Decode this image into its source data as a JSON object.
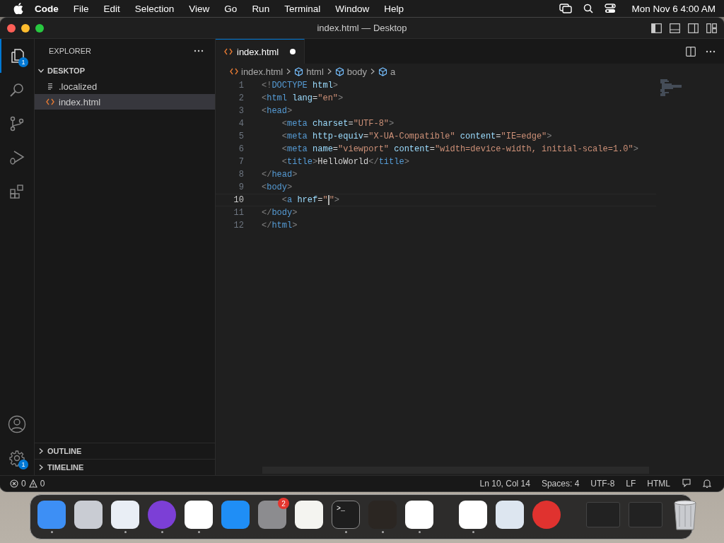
{
  "menu_bar": {
    "app_name": "Code",
    "items": [
      "File",
      "Edit",
      "Selection",
      "View",
      "Go",
      "Run",
      "Terminal",
      "Window",
      "Help"
    ],
    "clock": "Mon Nov 6  4:00 AM"
  },
  "window": {
    "title": "index.html — Desktop"
  },
  "activity_bar": {
    "items": [
      {
        "kind": "files",
        "selected": true,
        "badge": "1"
      },
      {
        "kind": "search",
        "selected": false
      },
      {
        "kind": "source-control",
        "selected": false
      },
      {
        "kind": "run-debug",
        "selected": false
      },
      {
        "kind": "extensions",
        "selected": false
      }
    ],
    "bottom_items": [
      {
        "kind": "account"
      },
      {
        "kind": "settings",
        "badge": "1"
      }
    ]
  },
  "sidebar": {
    "title": "EXPLORER",
    "folder": {
      "name": "DESKTOP",
      "expanded": true,
      "files": [
        {
          "name": ".localized",
          "kind": "plain",
          "selected": false
        },
        {
          "name": "index.html",
          "kind": "html",
          "selected": true
        }
      ]
    },
    "sections": [
      {
        "name": "OUTLINE",
        "expanded": false
      },
      {
        "name": "TIMELINE",
        "expanded": false
      }
    ]
  },
  "tabs": [
    {
      "label": "index.html",
      "selected": true,
      "modified": true
    }
  ],
  "breadcrumbs": [
    {
      "label": "index.html",
      "kind": "file"
    },
    {
      "label": "html",
      "kind": "element"
    },
    {
      "label": "body",
      "kind": "element"
    },
    {
      "label": "a",
      "kind": "element"
    }
  ],
  "code_lines": [
    {
      "number": "1",
      "current": false,
      "tokens": [
        {
          "kind": "punct",
          "text": "<!"
        },
        {
          "kind": "tag",
          "text": "DOCTYPE"
        },
        {
          "kind": "attr",
          "text": " html"
        },
        {
          "kind": "punct",
          "text": ">"
        }
      ]
    },
    {
      "number": "2",
      "current": false,
      "tokens": [
        {
          "kind": "punct",
          "text": "<"
        },
        {
          "kind": "tag",
          "text": "html"
        },
        {
          "kind": "attr",
          "text": " lang"
        },
        {
          "kind": "text",
          "text": "="
        },
        {
          "kind": "string",
          "text": "\"en\""
        },
        {
          "kind": "punct",
          "text": ">"
        }
      ]
    },
    {
      "number": "3",
      "current": false,
      "tokens": [
        {
          "kind": "punct",
          "text": "<"
        },
        {
          "kind": "tag",
          "text": "head"
        },
        {
          "kind": "punct",
          "text": ">"
        }
      ]
    },
    {
      "number": "4",
      "current": false,
      "tokens": [
        {
          "kind": "punct",
          "text": "    <"
        },
        {
          "kind": "tag",
          "text": "meta"
        },
        {
          "kind": "attr",
          "text": " charset"
        },
        {
          "kind": "text",
          "text": "="
        },
        {
          "kind": "string",
          "text": "\"UTF-8\""
        },
        {
          "kind": "punct",
          "text": ">"
        }
      ]
    },
    {
      "number": "5",
      "current": false,
      "tokens": [
        {
          "kind": "punct",
          "text": "    <"
        },
        {
          "kind": "tag",
          "text": "meta"
        },
        {
          "kind": "attr",
          "text": " http-equiv"
        },
        {
          "kind": "text",
          "text": "="
        },
        {
          "kind": "string",
          "text": "\"X-UA-Compatible\""
        },
        {
          "kind": "attr",
          "text": " content"
        },
        {
          "kind": "text",
          "text": "="
        },
        {
          "kind": "string",
          "text": "\"IE=edge\""
        },
        {
          "kind": "punct",
          "text": ">"
        }
      ]
    },
    {
      "number": "6",
      "current": false,
      "tokens": [
        {
          "kind": "punct",
          "text": "    <"
        },
        {
          "kind": "tag",
          "text": "meta"
        },
        {
          "kind": "attr",
          "text": " name"
        },
        {
          "kind": "text",
          "text": "="
        },
        {
          "kind": "string",
          "text": "\"viewport\""
        },
        {
          "kind": "attr",
          "text": " content"
        },
        {
          "kind": "text",
          "text": "="
        },
        {
          "kind": "string",
          "text": "\"width=device-width, initial-scale=1.0\""
        },
        {
          "kind": "punct",
          "text": ">"
        }
      ]
    },
    {
      "number": "7",
      "current": false,
      "tokens": [
        {
          "kind": "punct",
          "text": "    <"
        },
        {
          "kind": "tag",
          "text": "title"
        },
        {
          "kind": "punct",
          "text": ">"
        },
        {
          "kind": "text",
          "text": "HelloWorld"
        },
        {
          "kind": "punct",
          "text": "</"
        },
        {
          "kind": "tag",
          "text": "title"
        },
        {
          "kind": "punct",
          "text": ">"
        }
      ]
    },
    {
      "number": "8",
      "current": false,
      "tokens": [
        {
          "kind": "punct",
          "text": "</"
        },
        {
          "kind": "tag",
          "text": "head"
        },
        {
          "kind": "punct",
          "text": ">"
        }
      ]
    },
    {
      "number": "9",
      "current": false,
      "tokens": [
        {
          "kind": "punct",
          "text": "<"
        },
        {
          "kind": "tag",
          "text": "body"
        },
        {
          "kind": "punct",
          "text": ">"
        }
      ]
    },
    {
      "number": "10",
      "current": true,
      "tokens": [
        {
          "kind": "punct",
          "text": "    <"
        },
        {
          "kind": "tag",
          "text": "a"
        },
        {
          "kind": "attr",
          "text": " href"
        },
        {
          "kind": "text",
          "text": "="
        },
        {
          "kind": "string",
          "text": "\""
        },
        {
          "kind": "cursor"
        },
        {
          "kind": "string",
          "text": "\""
        },
        {
          "kind": "punct",
          "text": ">"
        }
      ]
    },
    {
      "number": "11",
      "current": false,
      "tokens": [
        {
          "kind": "punct",
          "text": "</"
        },
        {
          "kind": "tag",
          "text": "body"
        },
        {
          "kind": "punct",
          "text": ">"
        }
      ]
    },
    {
      "number": "12",
      "current": false,
      "tokens": [
        {
          "kind": "punct",
          "text": "</"
        },
        {
          "kind": "tag",
          "text": "html"
        },
        {
          "kind": "punct",
          "text": ">"
        }
      ]
    }
  ],
  "status_bar": {
    "errors": "0",
    "warnings": "0",
    "items": [
      "Ln 10, Col 14",
      "Spaces: 4",
      "UTF-8",
      "LF",
      "HTML"
    ]
  },
  "dock": {
    "apps": [
      {
        "kind": "finder",
        "running": true
      },
      {
        "kind": "launchpad",
        "running": false
      },
      {
        "kind": "safari",
        "running": true
      },
      {
        "kind": "firefox",
        "running": true
      },
      {
        "kind": "chrome",
        "running": true
      },
      {
        "kind": "app-store",
        "running": false
      },
      {
        "kind": "settings",
        "running": false,
        "badge": "2"
      },
      {
        "kind": "textedit",
        "running": false
      },
      {
        "kind": "terminal",
        "running": true,
        "label": ">_"
      },
      {
        "kind": "garageband",
        "running": true
      },
      {
        "kind": "vscode",
        "running": true
      }
    ],
    "recent_apps": [
      {
        "kind": "freeform",
        "running": true
      },
      {
        "kind": "preview",
        "running": false
      },
      {
        "kind": "m-app",
        "running": false
      }
    ],
    "windows": [
      {
        "kind": "window-thumb"
      },
      {
        "kind": "window-thumb"
      }
    ]
  }
}
